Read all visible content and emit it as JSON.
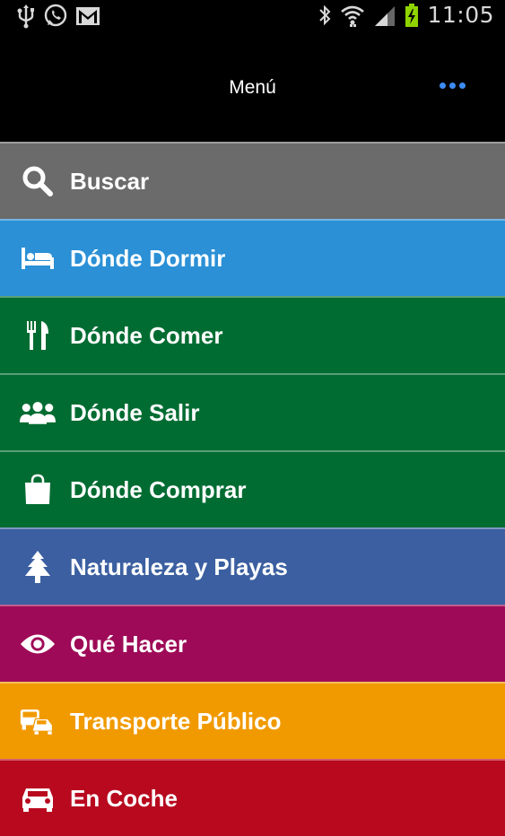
{
  "status_bar": {
    "left_icons": [
      "usb-icon",
      "whatsapp-icon",
      "gmail-icon"
    ],
    "right_icons": [
      "bluetooth-icon",
      "wifi-icon",
      "signal-icon",
      "battery-icon"
    ],
    "time": "11:05"
  },
  "app_bar": {
    "title": "Menú",
    "overflow_icon": "overflow-dots-icon",
    "accent_color": "#3d8cf5"
  },
  "menu": {
    "items": [
      {
        "label": "Buscar",
        "icon": "search-icon",
        "color": "#6b6b6b"
      },
      {
        "label": "Dónde Dormir",
        "icon": "bed-icon",
        "color": "#2b90d6"
      },
      {
        "label": "Dónde Comer",
        "icon": "cutlery-icon",
        "color": "#006c32"
      },
      {
        "label": "Dónde Salir",
        "icon": "people-icon",
        "color": "#006c32"
      },
      {
        "label": "Dónde Comprar",
        "icon": "shopping-bag-icon",
        "color": "#006c32"
      },
      {
        "label": "Naturaleza y Playas",
        "icon": "tree-icon",
        "color": "#3b5fa0"
      },
      {
        "label": "Qué Hacer",
        "icon": "eye-icon",
        "color": "#9e0a57"
      },
      {
        "label": "Transporte Público",
        "icon": "bus-icon",
        "color": "#f19a00"
      },
      {
        "label": "En Coche",
        "icon": "car-icon",
        "color": "#b8091f"
      }
    ]
  }
}
